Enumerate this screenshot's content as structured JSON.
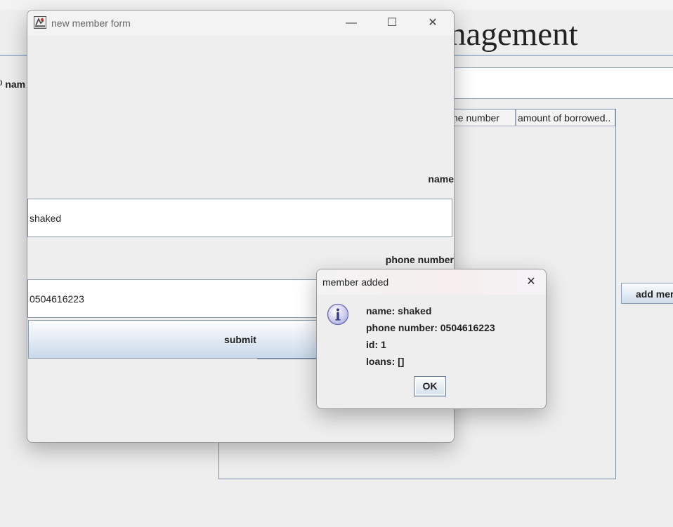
{
  "background_window": {
    "title_fragment": "nagement",
    "name_label_fragment": "⁾ nam",
    "table_headers": [
      "ne number",
      "amount of borrowed.."
    ],
    "add_button_fragment": "add mer"
  },
  "form_window": {
    "title": "new member form",
    "controls": {
      "minimize": "—",
      "maximize": "☐",
      "close": "✕"
    },
    "name_label": "name",
    "name_value": "shaked",
    "phone_label": "phone number",
    "phone_value": "0504616223",
    "submit_label": "submit"
  },
  "dialog": {
    "title": "member added",
    "close": "✕",
    "icon": "info-icon",
    "lines": [
      "name: shaked",
      "phone number: 0504616223",
      "id: 1",
      "loans: []"
    ],
    "ok_label": "OK"
  },
  "colors": {
    "button_gradient_top": "#fdfeff",
    "button_gradient_bottom": "#c9d9ea",
    "border_blue": "#8c9ab0",
    "window_bg": "#eeeeee"
  }
}
